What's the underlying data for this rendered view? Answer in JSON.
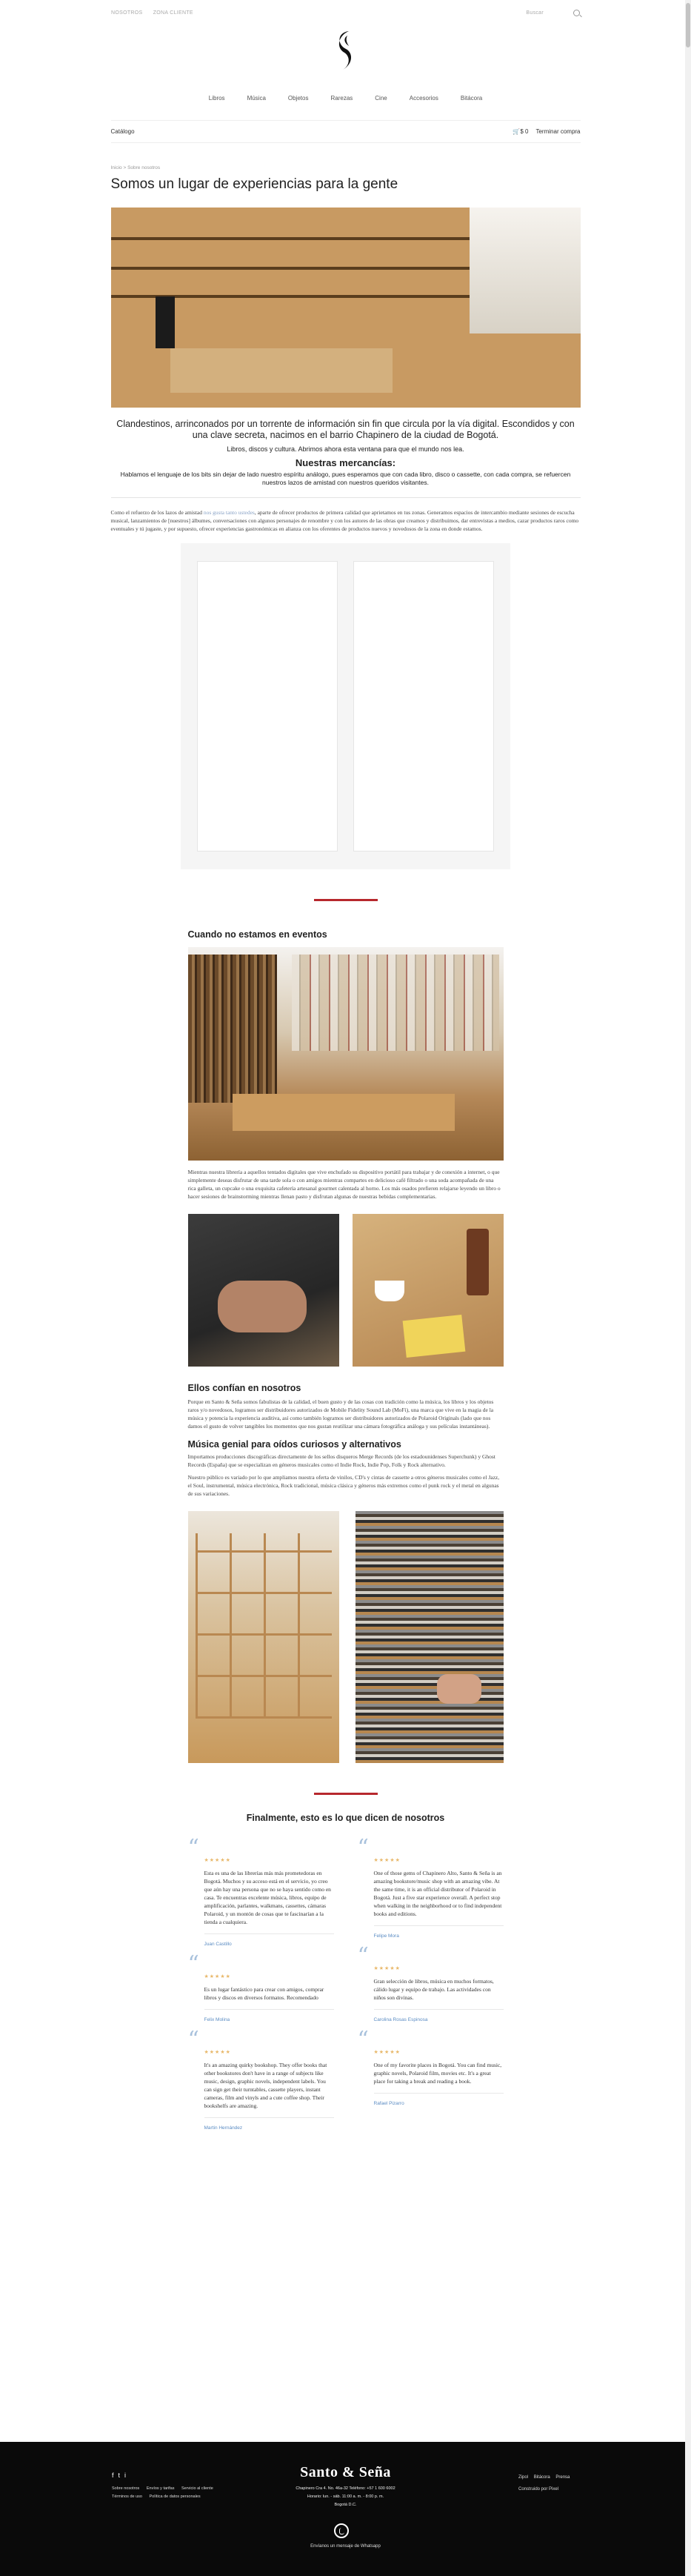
{
  "topbar": {
    "links": [
      "Nosotros",
      "Zona cliente"
    ],
    "search_placeholder": "Buscar"
  },
  "nav": [
    "Libros",
    "Música",
    "Objetos",
    "Rarezas",
    "Cine",
    "Accesorios",
    "Bitácora"
  ],
  "subbar": {
    "catalog": "Catálogo",
    "cart_count": "$ 0",
    "checkout": "Terminar compra"
  },
  "breadcrumb": "Inicio > Sobre nosotros",
  "page_title": "Somos un lugar de experiencias para la gente",
  "lead": {
    "line1": "Clandestinos, arrinconados por un torrente de información sin fin que circula por la vía digital. Escondidos y con una clave secreta, nacimos en el barrio Chapinero de la ciudad de Bogotá.",
    "line2": "Libros, discos y cultura. Abrimos ahora esta ventana para que el mundo nos lea.",
    "heading": "Nuestras mercancías:",
    "line3": "Hablamos el lenguaje de los bits sin dejar de lado nuestro espíritu análogo, pues esperamos que con cada libro, disco o cassette, con cada compra, se refuercen nuestros lazos de amistad con nuestros queridos visitantes."
  },
  "intro": {
    "pre": "Como el refuerzo de los lazos de amistad ",
    "link": "nos gusta tanto ustedes",
    "post": ", aparte de ofrecer productos de primera calidad que aprietamos en tus zonas. Generamos espacios de intercambio mediante sesiones de escucha musical, lanzamientos de [nuestros] álbumes, conversaciones con algunos personajes de renombre y con los autores de las obras que creamos y distribuimos, dar entrevistas a medios, cazar productos raros como eventuales y tú jugaste, y por supuesto, ofrecer experiencias gastronómicas en alianza con los oferentes de productos nuevos y novedosos de la zona en donde estamos."
  },
  "events": {
    "title": "Cuando no estamos en eventos",
    "text": "Mientras nuestra librería a aquellos tentados digitales que vive enchufado su dispositivo portátil para trabajar y de conexión a internet, o que simplemente deseas disfrutar de una tarde sola o con amigos mientras compartes en delicioso café filtrado o una soda acompañada de una rica galleta, un cupcake o una exquisita cafetería artesanal gourmet calentada al horno. Los más osados prefieren relajarse leyendo un libro o hacer sesiones de brainstorming mientras llenan pasto y disfrutan algunas de nuestras bebidas complementarias."
  },
  "trust": {
    "title": "Ellos confían en nosotros",
    "text": "Porque en Santo & Seña somos fabulistas de la calidad, el buen gusto y de las cosas con tradición como la música, los libros y los objetos raros y/o novedosos, logramos ser distribuidores autorizados de Mobile Fidelity Sound Lab (MoFi), una marca que vive en la magia de la música y potencia la experiencia auditiva, así como también logramos ser distribuidores autorizados de Polaroid Originals (lado que nos damos el gusto de volver tangibles los momentos que nos gustan reutilizar una cámara fotográfica análoga y sus películas instantáneas)."
  },
  "music": {
    "title": "Música genial para oídos curiosos y alternativos",
    "text1": "Importamos producciones discográficas directamente de los sellos disqueros Merge Records (de los estadounidenses Superchunk) y Ghost Records (España) que se especializan en géneros musicales como el Indie Rock, Indie Pop, Folk y Rock alternativo.",
    "text2": "Nuestro público es variado por lo que ampliamos nuestra oferta de vinilos, CD's y cintas de cassette a otros géneros musicales como el Jazz, el Soul, instrumental, música electrónica, Rock tradicional, música clásica y géneros más extremos como el punk rock y el metal en algunas de sus variaciones."
  },
  "testimonials_title": "Finalmente, esto es lo que dicen de nosotros",
  "testimonials_left": [
    {
      "stars": "★★★★★",
      "text": "Esta es una de las librerías más más prometedoras en Bogotá. Muchos y su acceso está en el servicio, yo creo que aún hay una persona que no se haya sentido como en casa. Te encuentras excelente música, libros, equipo de amplificación, parlantes, walkmans, cassettes, cámaras Polaroid, y un montón de cosas que te fascinarían a la tienda a cualquiera.",
      "author": "Juan Castillo"
    },
    {
      "stars": "★★★★★",
      "text": "Es un lugar fantástico para crear con amigos, comprar libros y discos en diversos formatos. Recomendado",
      "author": "Felix Molina"
    },
    {
      "stars": "★★★★★",
      "text": "It's an amazing quirky bookshop. They offer books that other bookstores don't have in a range of subjects like music, design, graphic novels, independent labels. You can sign get their turntables, cassette players, instant cameras, film and vinyls and a cute coffee shop. Their bookshelfs are amazing.",
      "author": "Martin Hernández"
    }
  ],
  "testimonials_right": [
    {
      "stars": "★★★★★",
      "text": "One of those gems of Chapinero Alto, Santo & Seña is an amazing bookstore/music shop with an amazing vibe. At the same time, it is an official distributor of Polaroid in Bogotá. Just a five star experience overall. A perfect stop when walking in the neighborhood or to find independent books and editions.",
      "author": "Felipe Mora"
    },
    {
      "stars": "★★★★★",
      "text": "Gran selección de libros, música en muchos formatos, cálido lugar y equipo de trabajo. Las actividades con niños son divinas.",
      "author": "Carolina Rosas Espinosa"
    },
    {
      "stars": "★★★★★",
      "text": "One of my favorite places in Bogotá. You can find music, graphic novels, Polaroid film, movies etc. It's a great place for taking a break and reading a book.",
      "author": "Rafael Pizarro"
    }
  ],
  "footer": {
    "social": [
      "f",
      "t",
      "i"
    ],
    "links": [
      "Sobre nosotros",
      "Envíos y tarifas",
      "Servicio al cliente",
      "Términos de uso",
      "Política de datos personales"
    ],
    "brand": "Santo & Seña",
    "address": [
      "Chapinero Cra 4. No. 46a-32 Teléfono: +57 1 600 6002",
      "Horario: lun. - sáb. 11:00 a. m. - 8:00 p. m.",
      "Bogotá D.C."
    ],
    "whatsapp": "Envíanos un mensaje de Whatsapp",
    "right_links": [
      "Zipol",
      "Bitácora",
      "Prensa"
    ],
    "credit": "Construido por Pixel"
  }
}
